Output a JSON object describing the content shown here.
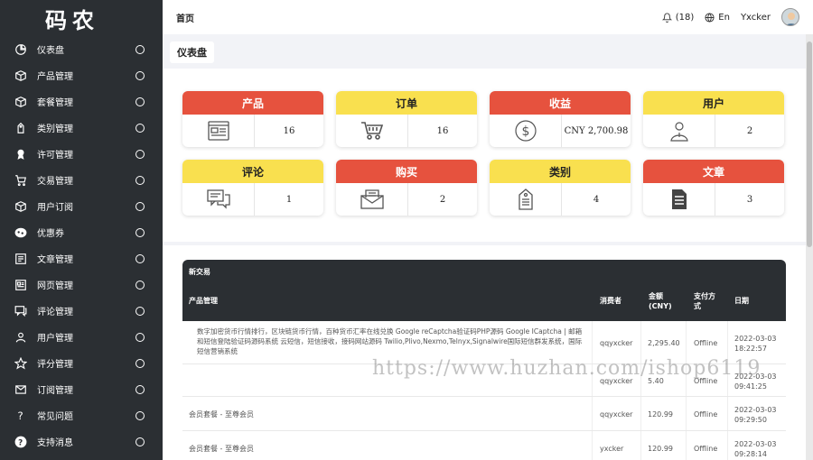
{
  "brand": "码农",
  "sidebar": {
    "items": [
      {
        "label": "仪表盘",
        "icon": "dashboard-icon"
      },
      {
        "label": "产品管理",
        "icon": "box-icon"
      },
      {
        "label": "套餐管理",
        "icon": "box-icon"
      },
      {
        "label": "类别管理",
        "icon": "tag-icon"
      },
      {
        "label": "许可管理",
        "icon": "award-icon"
      },
      {
        "label": "交易管理",
        "icon": "cart-icon"
      },
      {
        "label": "用户订阅",
        "icon": "box-icon"
      },
      {
        "label": "优惠券",
        "icon": "coupon-icon"
      },
      {
        "label": "文章管理",
        "icon": "article-icon"
      },
      {
        "label": "网页管理",
        "icon": "webpage-icon"
      },
      {
        "label": "评论管理",
        "icon": "comment-icon"
      },
      {
        "label": "用户管理",
        "icon": "user-icon"
      },
      {
        "label": "评分管理",
        "icon": "star-icon"
      },
      {
        "label": "订阅管理",
        "icon": "mail-icon"
      },
      {
        "label": "常见问题",
        "icon": "question-icon"
      },
      {
        "label": "支持消息",
        "icon": "help-circle-icon"
      }
    ]
  },
  "topbar": {
    "home": "首页",
    "notifications": "(18)",
    "language": "En",
    "username": "Yxcker"
  },
  "breadcrumb": "仪表盘",
  "stats": [
    {
      "label": "产品",
      "value": "16",
      "color": "red",
      "icon": "browser-icon"
    },
    {
      "label": "订单",
      "value": "16",
      "color": "yellow",
      "icon": "cart-icon"
    },
    {
      "label": "收益",
      "value": "CNY 2,700.98",
      "color": "red",
      "icon": "dollar-icon"
    },
    {
      "label": "用户",
      "value": "2",
      "color": "yellow",
      "icon": "user-icon"
    },
    {
      "label": "评论",
      "value": "1",
      "color": "yellow",
      "icon": "comment-icon"
    },
    {
      "label": "购买",
      "value": "2",
      "color": "red",
      "icon": "mail-icon"
    },
    {
      "label": "类别",
      "value": "4",
      "color": "yellow",
      "icon": "tag-icon"
    },
    {
      "label": "文章",
      "value": "3",
      "color": "red",
      "icon": "document-icon"
    }
  ],
  "transactions": {
    "title": "新交易",
    "headers": {
      "product": "产品管理",
      "buyer": "消费者",
      "amount": "金额\n(CNY)",
      "payment": "支付方\n式",
      "date": "日期"
    },
    "rows": [
      {
        "product": "数字加密货币行情排行，区块链货币行情，百种货币汇率在线兑换 Google reCaptcha验证码PHP源码 Google ICaptcha | 邮箱和短信登陆验证码源码系统 云短信，短信接收，接码网站源码 Twilio,Plivo,Nexmo,Telnyx,Signalwire国际短信群发系统，国际短信营销系统",
        "buyer": "qqyxcker",
        "amount": "2,295.40",
        "payment": "Offline",
        "date": "2022-03-03\n18:22:57"
      },
      {
        "product": "",
        "buyer": "qqyxcker",
        "amount": "5.40",
        "payment": "Offline",
        "date": "2022-03-03\n09:41:25"
      },
      {
        "product": "会员套餐 - 至尊会员",
        "buyer": "qqyxcker",
        "amount": "120.99",
        "payment": "Offline",
        "date": "2022-03-03\n09:29:50"
      },
      {
        "product": "会员套餐 - 至尊会员",
        "buyer": "yxcker",
        "amount": "120.99",
        "payment": "Offline",
        "date": "2022-03-03\n09:28:14"
      }
    ]
  },
  "watermark": "https://www.huzhan.com/ishop6119",
  "colors": {
    "red": "#e6523e",
    "yellow": "#f9e04f",
    "dark": "#2b2f33"
  }
}
